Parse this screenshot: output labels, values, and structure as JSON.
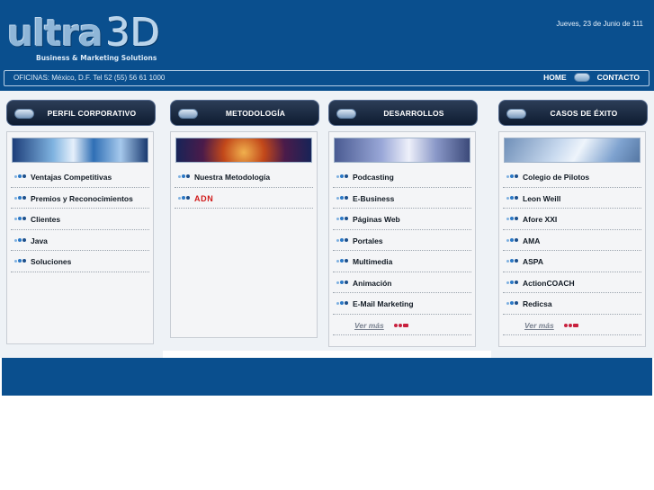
{
  "header": {
    "logo_word": "ultra",
    "logo_suffix": "3D",
    "tagline": "Business & Marketing Solutions",
    "date": "Jueves, 23 de Junio de 111",
    "offices": "OFICINAS: México, D.F. Tel 52 (55) 56 61 1000",
    "nav": {
      "home": "HOME",
      "contact": "CONTACTO"
    },
    "colors": {
      "background": "#0a4f8e",
      "nav_text": "#ffffff"
    }
  },
  "columns": [
    {
      "title": "PERFIL CORPORATIVO",
      "items": [
        "Ventajas Competitivas",
        "Premios y Reconocimientos",
        "Clientes",
        "Java",
        "Soluciones"
      ]
    },
    {
      "title": "METODOLOGÍA",
      "items": [
        "Nuestra Metodología"
      ],
      "highlight_item": "ADN"
    },
    {
      "title": "DESARROLLOS",
      "items": [
        "Podcasting",
        "E-Business",
        "Páginas Web",
        "Portales",
        "Multimedia",
        "Animación",
        "E-Mail Marketing"
      ],
      "more": "Ver más"
    },
    {
      "title": "CASOS DE ÉXITO",
      "items": [
        "Colegio de Pilotos",
        "Leon Weill",
        "Afore XXI",
        "AMA",
        "ASPA",
        "ActionCOACH",
        "Redicsa"
      ],
      "more": "Ver más"
    }
  ],
  "colors": {
    "column_header": "#1a2a44",
    "bullet_blue": "#2b79c7",
    "highlight_red": "#d11b1b",
    "more_arrow": "#c8203e",
    "footer": "#0a4f8e"
  }
}
